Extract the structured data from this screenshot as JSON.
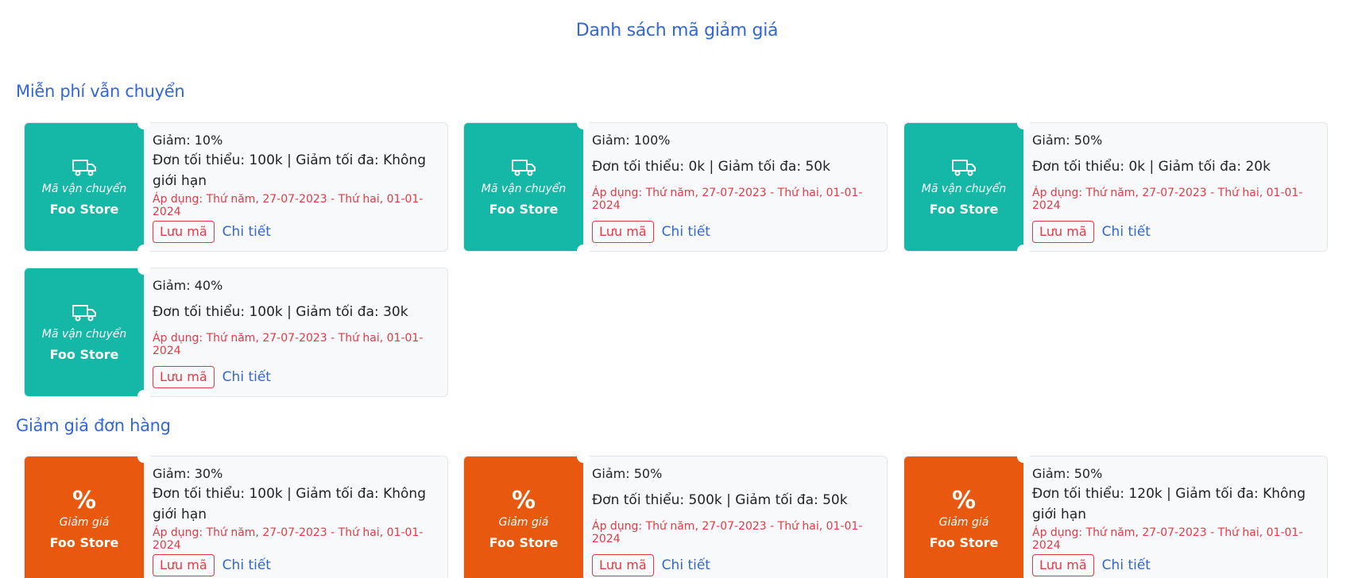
{
  "page": {
    "title": "Danh sách mã giảm giá"
  },
  "sections": [
    {
      "title": "Miễn phí vẫn chuyển",
      "type_label": "Mã vận chuyển",
      "icon": "truck-icon",
      "color": "#15b7a6",
      "vouchers": [
        {
          "discount": "Giảm: 10%",
          "conditions": "Đơn tối thiểu: 100k | Giảm tối đa: Không giới hạn",
          "validity": "Áp dụng: Thứ năm, 27-07-2023 - Thứ hai, 01-01-2024",
          "store": "Foo Store",
          "save_label": "Lưu mã",
          "detail_label": "Chi tiết"
        },
        {
          "discount": "Giảm: 100%",
          "conditions": "Đơn tối thiểu: 0k | Giảm tối đa: 50k",
          "validity": "Áp dụng: Thứ năm, 27-07-2023 - Thứ hai, 01-01-2024",
          "store": "Foo Store",
          "save_label": "Lưu mã",
          "detail_label": "Chi tiết"
        },
        {
          "discount": "Giảm: 50%",
          "conditions": "Đơn tối thiểu: 0k | Giảm tối đa: 20k",
          "validity": "Áp dụng: Thứ năm, 27-07-2023 - Thứ hai, 01-01-2024",
          "store": "Foo Store",
          "save_label": "Lưu mã",
          "detail_label": "Chi tiết"
        },
        {
          "discount": "Giảm: 40%",
          "conditions": "Đơn tối thiểu: 100k | Giảm tối đa: 30k",
          "validity": "Áp dụng: Thứ năm, 27-07-2023 - Thứ hai, 01-01-2024",
          "store": "Foo Store",
          "save_label": "Lưu mã",
          "detail_label": "Chi tiết"
        }
      ]
    },
    {
      "title": "Giảm giá đơn hàng",
      "type_label": "Giảm giá",
      "icon": "percent-icon",
      "icon_glyph": "%",
      "color": "#e8580f",
      "vouchers": [
        {
          "discount": "Giảm: 30%",
          "conditions": "Đơn tối thiểu: 100k | Giảm tối đa: Không giới hạn",
          "validity": "Áp dụng: Thứ năm, 27-07-2023 - Thứ hai, 01-01-2024",
          "store": "Foo Store",
          "save_label": "Lưu mã",
          "detail_label": "Chi tiết"
        },
        {
          "discount": "Giảm: 50%",
          "conditions": "Đơn tối thiểu: 500k | Giảm tối đa: 50k",
          "validity": "Áp dụng: Thứ năm, 27-07-2023 - Thứ hai, 01-01-2024",
          "store": "Foo Store",
          "save_label": "Lưu mã",
          "detail_label": "Chi tiết"
        },
        {
          "discount": "Giảm: 50%",
          "conditions": "Đơn tối thiểu: 120k | Giảm tối đa: Không giới hạn",
          "validity": "Áp dụng: Thứ năm, 27-07-2023 - Thứ hai, 01-01-2024",
          "store": "Foo Store",
          "save_label": "Lưu mã",
          "detail_label": "Chi tiết"
        }
      ]
    }
  ]
}
